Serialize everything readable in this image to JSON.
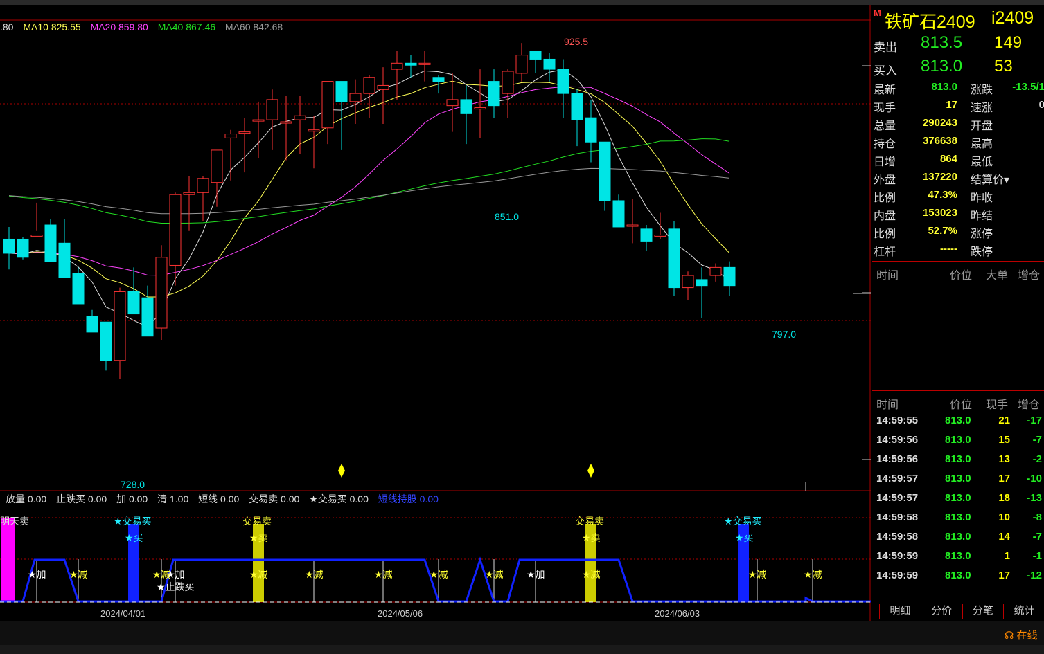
{
  "legend_ma": [
    {
      "text": ".80",
      "color": "#dddddd"
    },
    {
      "text": "MA10 825.55",
      "color": "#ffff55"
    },
    {
      "text": "MA20 859.80",
      "color": "#ff44ff"
    },
    {
      "text": "MA40 867.46",
      "color": "#22dd22"
    },
    {
      "text": "MA60 842.68",
      "color": "#999999"
    }
  ],
  "indicator_legend": [
    {
      "text": "放量 0.00",
      "color": "#dddddd"
    },
    {
      "text": "止跌买 0.00",
      "color": "#dddddd"
    },
    {
      "text": "加 0.00",
      "color": "#dddddd"
    },
    {
      "text": "清 1.00",
      "color": "#dddddd"
    },
    {
      "text": "短线 0.00",
      "color": "#dddddd"
    },
    {
      "text": "交易卖 0.00",
      "color": "#dddddd"
    },
    {
      "text": "★交易买 0.00",
      "color": "#dddddd"
    },
    {
      "text": "短线持股 0.00",
      "color": "#3344ff"
    }
  ],
  "price_labels": {
    "high": "925.5",
    "low1": "851.0",
    "low2": "797.0",
    "low3": "728.0"
  },
  "signal_labels": {
    "s1": "明天卖",
    "s2": "★交易买",
    "s2b": "★买",
    "s3": "交易卖",
    "s3b": "★卖",
    "s4": "交易卖",
    "s4b": "★卖",
    "s5": "★交易买",
    "s5b": "★买",
    "add": "★加",
    "reduce": "★减",
    "stopbuy": "★止跌买"
  },
  "dates": [
    "2024/04/01",
    "2024/05/06",
    "2024/06/03"
  ],
  "quote": {
    "name": "铁矿石2409",
    "code": "i2409",
    "flag": "M",
    "ask_label": "卖出",
    "ask_price": "813.5",
    "ask_vol": "149",
    "bid_label": "买入",
    "bid_price": "813.0",
    "bid_vol": "53",
    "rows": [
      {
        "l1": "最新",
        "v1": "813.0",
        "c1": "#22ee22",
        "l2": "涨跌",
        "v2": "-13.5/1",
        "c2": "#22ee22"
      },
      {
        "l1": "现手",
        "v1": "17",
        "c1": "#ffff33",
        "l2": "速涨",
        "v2": "0",
        "c2": "#dddddd"
      },
      {
        "l1": "总量",
        "v1": "290243",
        "c1": "#ffff33",
        "l2": "开盘",
        "v2": "",
        "c2": "#dddddd"
      },
      {
        "l1": "持仓",
        "v1": "376638",
        "c1": "#ffff33",
        "l2": "最高",
        "v2": "",
        "c2": "#dddddd"
      },
      {
        "l1": "日增",
        "v1": "864",
        "c1": "#ffff33",
        "l2": "最低",
        "v2": "",
        "c2": "#dddddd"
      },
      {
        "l1": "外盘",
        "v1": "137220",
        "c1": "#ffff33",
        "l2": "结算价▾",
        "v2": "",
        "c2": "#dddddd"
      },
      {
        "l1": "比例",
        "v1": "47.3%",
        "c1": "#ffff33",
        "l2": "昨收",
        "v2": "",
        "c2": "#dddddd"
      },
      {
        "l1": "内盘",
        "v1": "153023",
        "c1": "#ffff33",
        "l2": "昨结",
        "v2": "",
        "c2": "#dddddd"
      },
      {
        "l1": "比例",
        "v1": "52.7%",
        "c1": "#ffff33",
        "l2": "涨停",
        "v2": "",
        "c2": "#dddddd"
      },
      {
        "l1": "杠杆",
        "v1": "-----",
        "c1": "#ffff33",
        "l2": "跌停",
        "v2": "",
        "c2": "#dddddd"
      }
    ]
  },
  "big_orders_header": {
    "time": "时间",
    "price": "价位",
    "big": "大单",
    "inc": "增仓"
  },
  "ticks_header": {
    "time": "时间",
    "price": "价位",
    "vol": "现手",
    "inc": "增仓"
  },
  "ticks": [
    {
      "time": "14:59:55",
      "price": "813.0",
      "vol": "21",
      "inc": "-17"
    },
    {
      "time": "14:59:56",
      "price": "813.0",
      "vol": "15",
      "inc": "-7"
    },
    {
      "time": "14:59:56",
      "price": "813.0",
      "vol": "13",
      "inc": "-2"
    },
    {
      "time": "14:59:57",
      "price": "813.0",
      "vol": "17",
      "inc": "-10"
    },
    {
      "time": "14:59:57",
      "price": "813.0",
      "vol": "18",
      "inc": "-13"
    },
    {
      "time": "14:59:58",
      "price": "813.0",
      "vol": "10",
      "inc": "-8"
    },
    {
      "time": "14:59:58",
      "price": "813.0",
      "vol": "14",
      "inc": "-7"
    },
    {
      "time": "14:59:59",
      "price": "813.0",
      "vol": "1",
      "inc": "-1"
    },
    {
      "time": "14:59:59",
      "price": "813.0",
      "vol": "17",
      "inc": "-12"
    }
  ],
  "tabs": [
    "明细",
    "分价",
    "分笔",
    "统计"
  ],
  "online_text": "在线",
  "colors": {
    "up": "#ff3333",
    "down": "#00e5e5",
    "grid": "#aa0000"
  },
  "chart_data": {
    "type": "candlestick",
    "candles": [
      [
        836,
        842,
        829,
        821
      ],
      [
        836,
        837,
        827,
        826
      ],
      [
        838,
        854,
        838,
        840
      ],
      [
        843,
        846,
        825,
        840
      ],
      [
        834,
        846,
        817,
        819
      ],
      [
        819,
        822,
        804,
        805
      ],
      [
        798,
        801,
        790,
        795
      ],
      [
        795,
        793,
        776,
        771
      ],
      [
        776,
        812,
        810,
        767
      ],
      [
        810,
        822,
        799,
        808
      ],
      [
        807,
        813,
        788,
        788
      ],
      [
        792,
        833,
        827,
        786
      ],
      [
        823,
        859,
        858,
        813
      ],
      [
        858,
        867,
        859,
        840
      ],
      [
        859,
        867,
        866,
        845
      ],
      [
        864,
        880,
        880,
        852
      ],
      [
        886,
        890,
        888,
        865
      ],
      [
        889,
        896,
        889,
        869
      ],
      [
        895,
        904,
        895,
        876
      ],
      [
        895,
        910,
        905,
        880
      ],
      [
        894,
        907,
        894,
        875
      ],
      [
        895,
        907,
        897,
        878
      ],
      [
        890,
        897,
        890,
        871
      ],
      [
        891,
        914,
        914,
        883
      ],
      [
        914,
        914,
        904,
        880
      ],
      [
        904,
        915,
        908,
        893
      ],
      [
        908,
        917,
        916,
        896
      ],
      [
        910,
        921,
        912,
        893
      ],
      [
        920,
        929,
        923,
        905
      ],
      [
        923,
        927,
        922,
        916
      ],
      [
        923,
        929,
        923,
        914
      ],
      [
        916,
        917,
        914,
        908
      ],
      [
        902,
        918,
        905,
        889
      ],
      [
        905,
        912,
        898,
        883
      ],
      [
        901,
        920,
        901,
        886
      ],
      [
        914,
        920,
        902,
        896
      ],
      [
        908,
        920,
        919,
        896
      ],
      [
        918,
        933,
        927,
        914
      ],
      [
        929,
        929,
        925,
        918
      ],
      [
        925,
        928,
        920,
        914
      ],
      [
        920,
        925,
        908,
        896
      ],
      [
        908,
        910,
        895,
        882
      ],
      [
        896,
        905,
        884,
        874
      ],
      [
        884,
        884,
        855,
        850
      ],
      [
        855,
        858,
        842,
        843
      ],
      [
        843,
        856,
        843,
        834
      ],
      [
        841,
        843,
        835,
        830
      ],
      [
        838,
        849,
        838,
        836
      ],
      [
        841,
        845,
        812,
        808
      ],
      [
        812,
        820,
        818,
        806
      ],
      [
        816,
        822,
        813,
        797
      ],
      [
        818,
        824,
        822,
        815
      ],
      [
        822,
        825,
        813,
        808
      ]
    ],
    "ma_names": [
      "MA10",
      "MA20",
      "MA40",
      "MA60"
    ]
  }
}
